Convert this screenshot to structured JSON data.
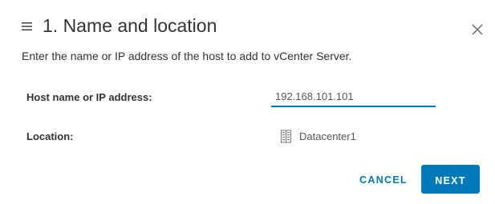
{
  "header": {
    "title": "1. Name and location",
    "subtitle": "Enter the name or IP address of the host to add to vCenter Server."
  },
  "form": {
    "host_label": "Host name or IP address:",
    "host_value": "192.168.101.101",
    "location_label": "Location:",
    "location_value": "Datacenter1",
    "location_icon": "datacenter-icon"
  },
  "footer": {
    "cancel_label": "CANCEL",
    "next_label": "NEXT"
  },
  "colors": {
    "accent": "#0079b8",
    "text": "#333333",
    "muted_text": "#555555",
    "icon": "#666666"
  }
}
